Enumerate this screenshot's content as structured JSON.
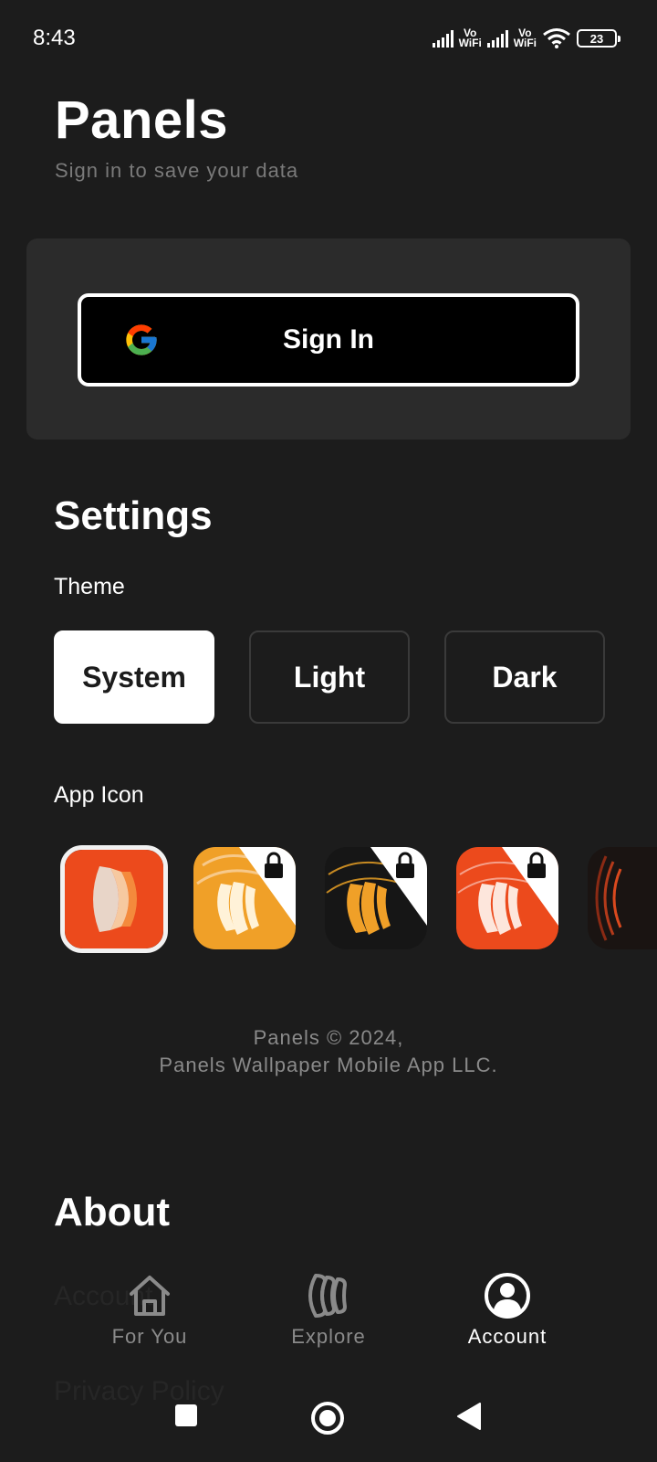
{
  "status_bar": {
    "time": "8:43",
    "network1": "Vo WiFi",
    "network2": "Vo WiFi",
    "battery": "23"
  },
  "header": {
    "title": "Panels",
    "subtitle": "Sign in to save your data"
  },
  "signin": {
    "label": "Sign In",
    "icon": "google-icon"
  },
  "settings": {
    "heading": "Settings",
    "theme_label": "Theme",
    "themes": [
      {
        "label": "System",
        "selected": true
      },
      {
        "label": "Light",
        "selected": false
      },
      {
        "label": "Dark",
        "selected": false
      }
    ],
    "app_icon_label": "App Icon",
    "app_icons": [
      {
        "name": "default",
        "locked": false,
        "selected": true
      },
      {
        "name": "gold",
        "locked": true,
        "selected": false
      },
      {
        "name": "black-gold",
        "locked": true,
        "selected": false
      },
      {
        "name": "red",
        "locked": true,
        "selected": false
      },
      {
        "name": "dark-red",
        "locked": false,
        "selected": false
      }
    ]
  },
  "footer": {
    "line1": "Panels © 2024,",
    "line2": "Panels Wallpaper Mobile App LLC."
  },
  "about": {
    "heading": "About",
    "items": [
      "Account",
      "Privacy Policy"
    ]
  },
  "bottom_nav": {
    "items": [
      {
        "label": "For You",
        "icon": "home-icon",
        "active": false
      },
      {
        "label": "Explore",
        "icon": "explore-icon",
        "active": false
      },
      {
        "label": "Account",
        "icon": "account-icon",
        "active": true
      }
    ]
  },
  "colors": {
    "background": "#1c1c1c",
    "card": "#2b2b2b",
    "accent_orange": "#ec4a1c",
    "accent_gold": "#f0a028"
  }
}
